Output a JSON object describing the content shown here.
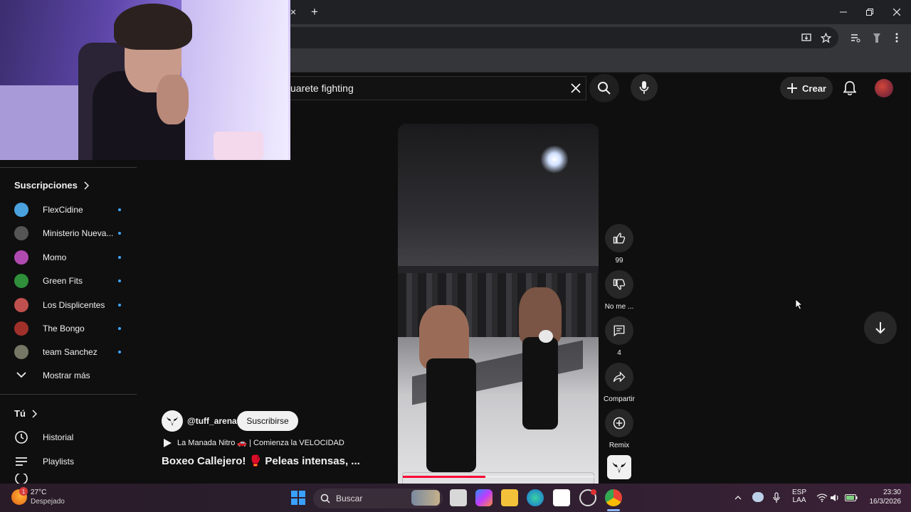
{
  "browser": {
    "new_tab": "+",
    "close_tab": "✕",
    "window_controls": [
      "minimize-icon",
      "restore-icon",
      "close-icon"
    ]
  },
  "header": {
    "search_value": "uarete fighting",
    "create_label": "Crear"
  },
  "sidebar": {
    "subscriptions_title": "Suscripciones",
    "subscriptions": [
      {
        "name": "FlexCidine",
        "color": "#4aa3df"
      },
      {
        "name": "Ministerio Nueva...",
        "color": "#555555"
      },
      {
        "name": "Momo",
        "color": "#b04ab0"
      },
      {
        "name": "Green Fits",
        "color": "#2f8f3a"
      },
      {
        "name": "Los Displicentes",
        "color": "#c0504d"
      },
      {
        "name": "The Bongo",
        "color": "#a0302a"
      },
      {
        "name": "team Sanchez",
        "color": "#777766"
      }
    ],
    "show_more": "Mostrar más",
    "you_title": "Tú",
    "history": "Historial",
    "playlists": "Playlists"
  },
  "short": {
    "channel": "@tuff_arena",
    "subscribe": "Suscribirse",
    "music": "La Manada Nitro 🚗 | Comienza la VELOCIDAD",
    "title": "Boxeo Callejero! 🥊 Peleas intensas, ...",
    "likes": "99",
    "dislike": "No me ...",
    "comments": "4",
    "share": "Compartir",
    "remix": "Remix",
    "progress": 0.43
  },
  "taskbar": {
    "temp": "27°C",
    "weather": "Despejado",
    "weather_badge": "1",
    "search": "Buscar",
    "lang1": "ESP",
    "lang2": "LAA",
    "time": "23:30",
    "date": "16/3/2026"
  }
}
